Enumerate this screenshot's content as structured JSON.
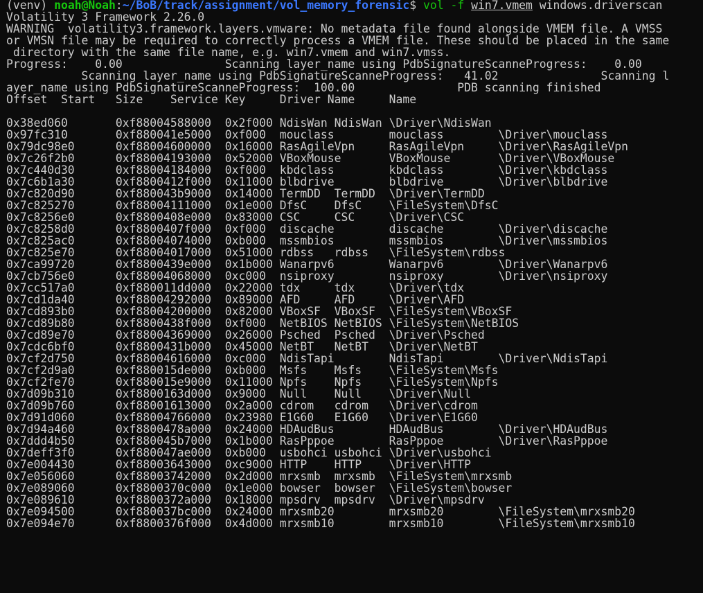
{
  "prompt": {
    "venv": "(venv)",
    "user_host": "noah@Noah",
    "colon": ":",
    "path": "~/BoB/track/assignment/vol_memory_forensic",
    "dollar": "$",
    "command": "vol",
    "flag": "-f",
    "file": "win7.vmem",
    "plugin": "windows.driverscan"
  },
  "output_header": [
    "Volatility 3 Framework 2.26.0",
    "WARNING  volatility3.framework.layers.vmware: No metadata file found alongside VMEM file. A VMSS",
    "or VMSN file may be required to correctly process a VMEM file. These should be placed in the same",
    " directory with the same file name, e.g. win7.vmem and win7.vmss.",
    "Progress:    0.00               Scanning layer_name using PdbSignatureScanneProgress:    0.00",
    "           Scanning layer_name using PdbSignatureScanneProgress:   41.02               Scanning l",
    "ayer_name using PdbSignatureScanneProgress:  100.00               PDB scanning finished",
    "Offset  Start   Size    Service Key     Driver Name     Name"
  ],
  "rows": [
    "0x38ed060       0xf88004588000  0x2f000 NdisWan NdisWan \\Driver\\NdisWan",
    "0x97fc310       0xf880041e5000  0xf000  mouclass        mouclass        \\Driver\\mouclass",
    "0x79dc98e0      0xf88004600000  0x16000 RasAgileVpn     RasAgileVpn     \\Driver\\RasAgileVpn",
    "0x7c26f2b0      0xf88004193000  0x52000 VBoxMouse       VBoxMouse       \\Driver\\VBoxMouse",
    "0x7c440d30      0xf88004184000  0xf000  kbdclass        kbdclass        \\Driver\\kbdclass",
    "0x7c6b1a30      0xf8800412f000  0x11000 blbdrive        blbdrive        \\Driver\\blbdrive",
    "0x7c820d90      0xf880043b9000  0x14000 TermDD  TermDD  \\Driver\\TermDD",
    "0x7c825270      0xf88004111000  0x1e000 DfsC    DfsC    \\FileSystem\\DfsC",
    "0x7c8256e0      0xf8800408e000  0x83000 CSC     CSC     \\Driver\\CSC",
    "0x7c8258d0      0xf8800407f000  0xf000  discache        discache        \\Driver\\discache",
    "0x7c825ac0      0xf88004074000  0xb000  mssmbios        mssmbios        \\Driver\\mssmbios",
    "0x7c825e70      0xf88004017000  0x51000 rdbss   rdbss   \\FileSystem\\rdbss",
    "0x7ca99720      0xf8800439e000  0x1b000 Wanarpv6        Wanarpv6        \\Driver\\Wanarpv6",
    "0x7cb756e0      0xf88004068000  0xc000  nsiproxy        nsiproxy        \\Driver\\nsiproxy",
    "0x7cc517a0      0xf880011dd000  0x22000 tdx     tdx     \\Driver\\tdx",
    "0x7cd1da40      0xf88004292000  0x89000 AFD     AFD     \\Driver\\AFD",
    "0x7cd893b0      0xf88004200000  0x82000 VBoxSF  VBoxSF  \\FileSystem\\VBoxSF",
    "0x7cd89b80      0xf8800438f000  0xf000  NetBIOS NetBIOS \\FileSystem\\NetBIOS",
    "0x7cd89e70      0xf88004369000  0x26000 Psched  Psched  \\Driver\\Psched",
    "0x7cdc6bf0      0xf8800431b000  0x45000 NetBT   NetBT   \\Driver\\NetBT",
    "0x7cf2d750      0xf88004616000  0xc000  NdisTapi        NdisTapi        \\Driver\\NdisTapi",
    "0x7cf2d9a0      0xf880015de000  0xb000  Msfs    Msfs    \\FileSystem\\Msfs",
    "0x7cf2fe70      0xf880015e9000  0x11000 Npfs    Npfs    \\FileSystem\\Npfs",
    "0x7d09b310      0xf8800163d000  0x9000  Null    Null    \\Driver\\Null",
    "0x7d09b760      0xf88001613000  0x2a000 cdrom   cdrom   \\Driver\\cdrom",
    "0x7d91d060      0xf88004766000  0x23980 E1G60   E1G60   \\Driver\\E1G60",
    "0x7d94a460      0xf8800478a000  0x24000 HDAudBus        HDAudBus        \\Driver\\HDAudBus",
    "0x7ddd4b50      0xf880045b7000  0x1b000 RasPppoe        RasPppoe        \\Driver\\RasPppoe",
    "0x7deff3f0      0xf880047ae000  0xb000  usbohci usbohci \\Driver\\usbohci",
    "0x7e004430      0xf88003643000  0xc9000 HTTP    HTTP    \\Driver\\HTTP",
    "0x7e056060      0xf88003742000  0x2d000 mrxsmb  mrxsmb  \\FileSystem\\mrxsmb",
    "0x7e089060      0xf8800370c000  0x1e000 bowser  bowser  \\FileSystem\\bowser",
    "0x7e089610      0xf8800372a000  0x18000 mpsdrv  mpsdrv  \\Driver\\mpsdrv",
    "0x7e094500      0xf880037bc000  0x24000 mrxsmb20        mrxsmb20        \\FileSystem\\mrxsmb20",
    "0x7e094e70      0xf8800376f000  0x4d000 mrxsmb10        mrxsmb10        \\FileSystem\\mrxsmb10"
  ]
}
